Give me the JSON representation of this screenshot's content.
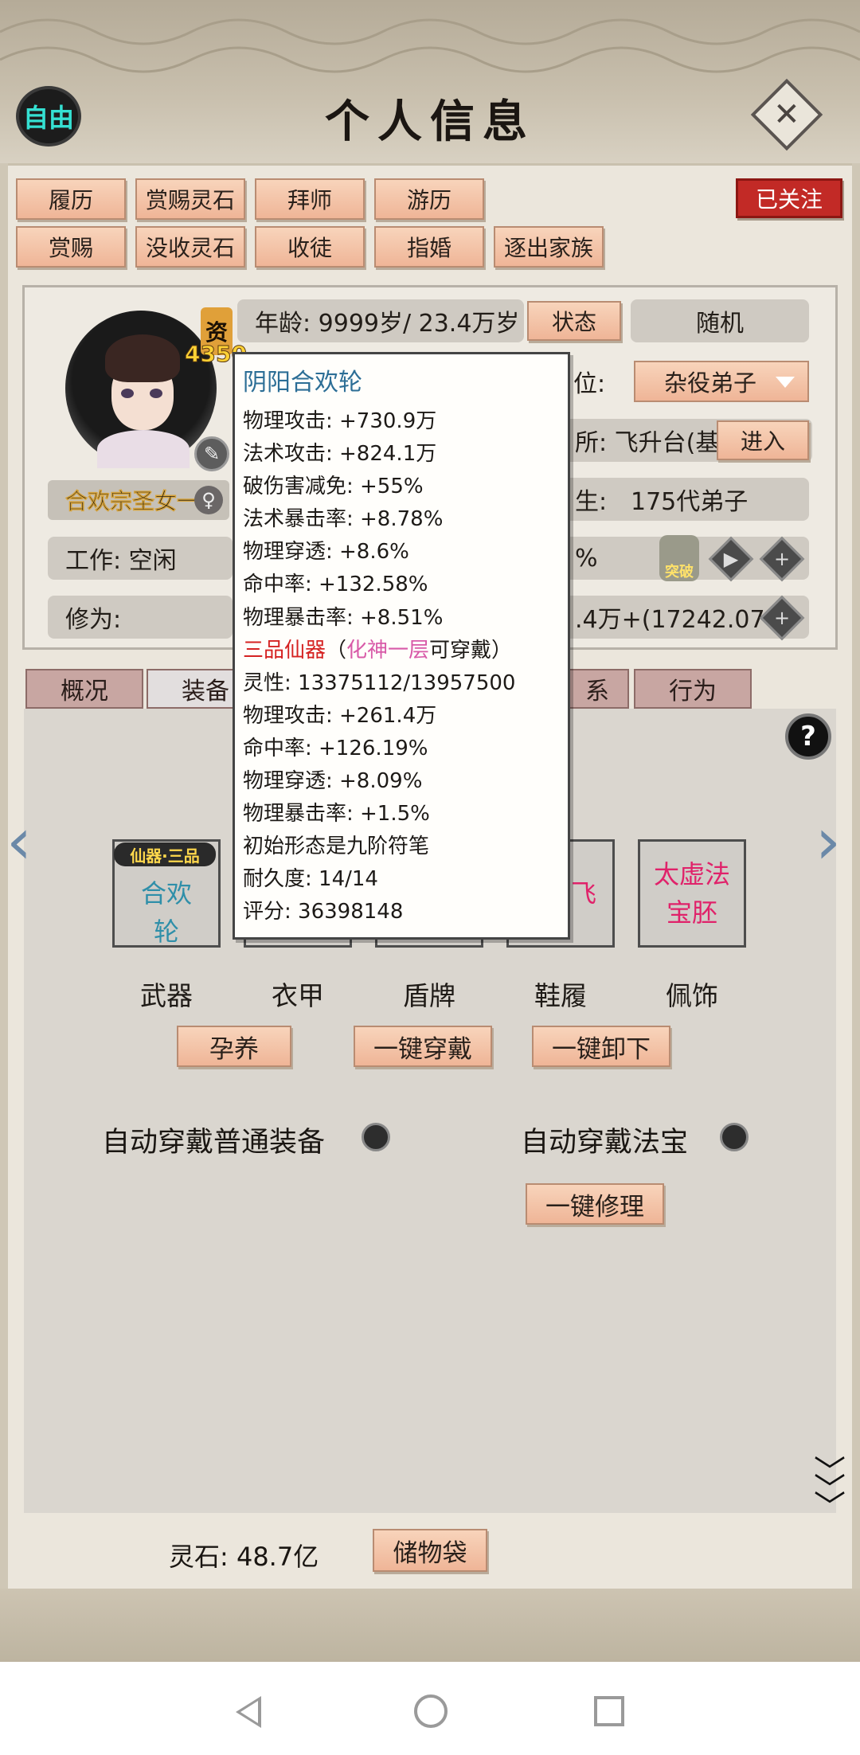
{
  "header": {
    "title": "个人信息",
    "free_label": "自由"
  },
  "actions_row1": [
    "履历",
    "赏赐灵石",
    "拜师",
    "游历"
  ],
  "actions_row2": [
    "赏赐",
    "没收灵石",
    "收徒",
    "指婚",
    "逐出家族"
  ],
  "followed_label": "已关注",
  "profile": {
    "talent_char": "资",
    "talent_value": "4350",
    "name": "合欢宗圣女一",
    "age": "年龄: 9999岁/ 23.4万岁",
    "status_button": "状态",
    "random_button": "随机",
    "position_label": "位:",
    "position_value": "杂役弟子",
    "location_label": "所: 飞升台(基",
    "enter_button": "进入",
    "generation_label": "生:",
    "generation_value": "175代弟子",
    "work": "工作: 空闲",
    "percent_fragment": "%",
    "cultivation_label": "修为:",
    "cultivation_value": ".4万+(17242.07%",
    "breakthrough_label": "突破"
  },
  "tabs": [
    "概况",
    "装备",
    "系",
    "行为"
  ],
  "tooltip": {
    "title": "阴阳合欢轮",
    "base_stats": [
      "物理攻击: +730.9万",
      "法术攻击: +824.1万",
      "破伤害减免: +55%",
      "法术暴击率: +8.78%",
      "物理穿透: +8.6%",
      "命中率: +132.58%",
      "物理暴击率: +8.51%"
    ],
    "grade": "三品仙器",
    "req_open": "（",
    "requirement": "化神一层",
    "req_close": "可穿戴）",
    "spirit": "灵性: 13375112/13957500",
    "spirit_stats": [
      "物理攻击: +261.4万",
      "命中率: +126.19%",
      "物理穿透: +8.09%",
      "物理暴击率: +1.5%"
    ],
    "origin": "初始形态是九阶符笔",
    "durability": "耐久度: 14/14",
    "score": "评分: 36398148"
  },
  "slots": {
    "weapon_tag": "仙器·三品",
    "weapon_name": "阴阳合欢轮",
    "shoes_fragment": "飞",
    "accessory_name": "太虚法宝胚",
    "labels": [
      "武器",
      "衣甲",
      "盾牌",
      "鞋履",
      "佩饰"
    ]
  },
  "equip_actions": {
    "nurture": "孕养",
    "equip_all": "一键穿戴",
    "unequip_all": "一键卸下",
    "repair_all": "一键修理"
  },
  "toggles": {
    "auto_normal": "自动穿戴普通装备",
    "auto_artifact": "自动穿戴法宝"
  },
  "footer": {
    "spirit_stones": "灵石: 48.7亿",
    "storage_bag": "储物袋"
  },
  "colors": {
    "accent_button": "#efb597",
    "followed_red": "#c22a26",
    "tooltip_title": "#2c6e96",
    "grade_red": "#d52222",
    "realm_pink": "#d85aa8",
    "slot_pink": "#e0226a"
  }
}
